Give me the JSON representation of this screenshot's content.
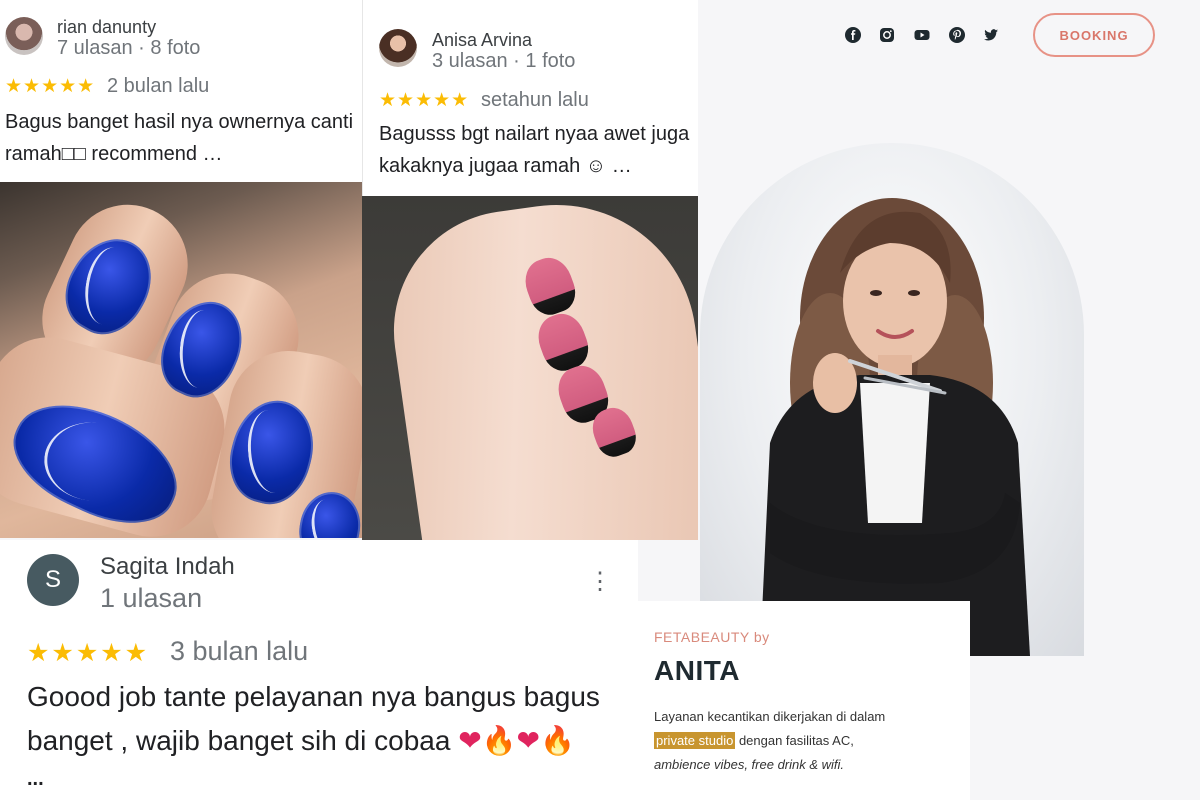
{
  "review1": {
    "reviewer": "rian danunty",
    "meta": "7 ulasan · 8 foto",
    "stars": "★★★★★",
    "time": "2 bulan lalu",
    "text_line1": "Bagus banget hasil nya ownernya canti",
    "text_line2": "ramah□□ recommend …"
  },
  "review2": {
    "reviewer": "Anisa Arvina",
    "meta": "3 ulasan · 1 foto",
    "stars": "★★★★★",
    "time": "setahun lalu",
    "text_line1": "Bagusss bgt nailart nyaa awet juga",
    "text_line2": "kakaknya jugaa ramah ☺ …"
  },
  "review3": {
    "avatar_letter": "S",
    "reviewer": "Sagita Indah",
    "meta": "1 ulasan",
    "more_icon": "⋮",
    "stars": "★★★★★",
    "time": "3 bulan lalu",
    "text_line1": "Goood job tante pelayanan nya bangus bagus",
    "text_line2": "banget , wajib banget sih di cobaa",
    "emoji": [
      "❤",
      "🔥",
      "❤",
      "🔥"
    ],
    "ellipsis": "..."
  },
  "site": {
    "social_icons": [
      "facebook-icon",
      "instagram-icon",
      "youtube-icon",
      "pinterest-icon",
      "twitter-icon"
    ],
    "booking_label": "BOOKING",
    "brand": "FETABEAUTY by",
    "title": "ANITA",
    "desc_part1": "Layanan kecantikan dikerjakan di dalam",
    "desc_highlight": "private studio",
    "desc_part2": " dengan fasilitas AC,",
    "desc_italic": "ambience vibes, free drink & wifi.",
    "accent_color": "#d9766a",
    "highlight_color": "#c8952f"
  }
}
